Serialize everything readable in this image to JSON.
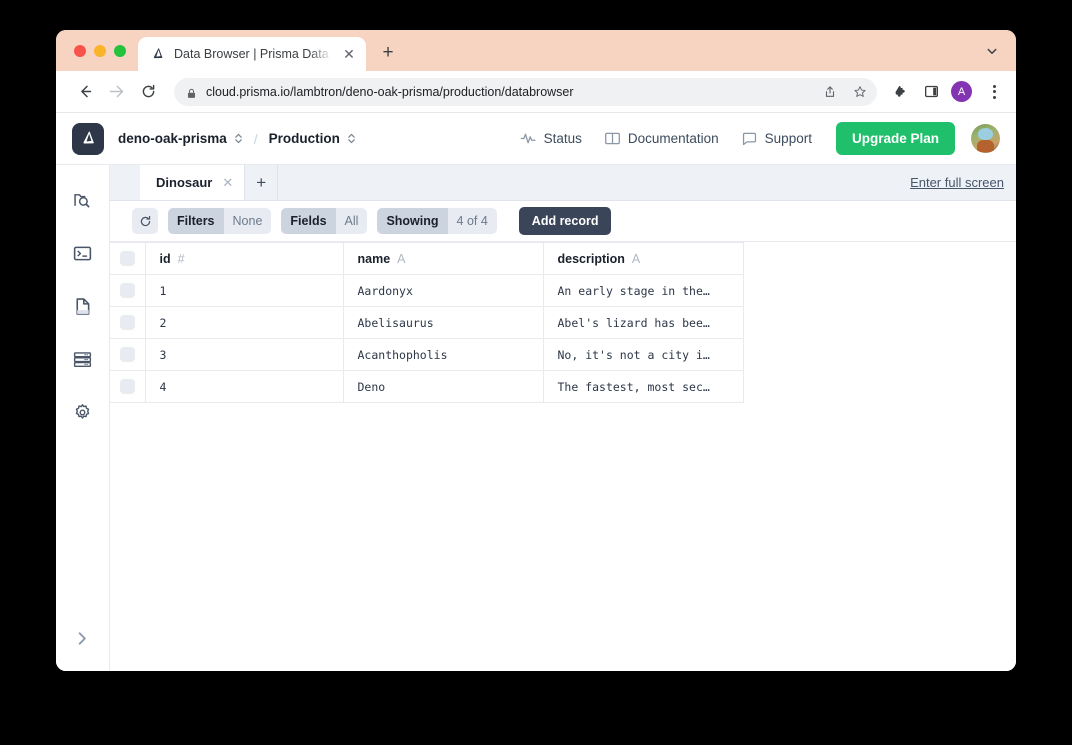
{
  "browser": {
    "tab": {
      "title": "Data Browser | Prisma Data Pla",
      "favicon": "prisma-logo-icon",
      "close": "✕"
    },
    "new_tab": "+",
    "tab_search": "chevron-down-icon",
    "nav": {
      "back": "←",
      "forward": "→",
      "reload": "↻"
    },
    "omnibox": {
      "url": "cloud.prisma.io/lambtron/deno-oak-prisma/production/databrowser",
      "lock": "lock-icon",
      "share": "share-icon",
      "bookmark": "☆"
    },
    "toolbar_icons": {
      "extensions": "puzzle-icon",
      "sidepanel": "side-panel-icon",
      "menu": "kebab-menu-icon"
    },
    "profile_initial": "A",
    "profile_color": "#8334b3"
  },
  "header": {
    "logo": "prisma-logo-icon",
    "project": "deno-oak-prisma",
    "separator": "/",
    "environment": "Production",
    "links": [
      {
        "label": "Status",
        "icon": "activity-pulse-icon"
      },
      {
        "label": "Documentation",
        "icon": "book-icon"
      },
      {
        "label": "Support",
        "icon": "chat-bubble-icon"
      }
    ],
    "upgrade_label": "Upgrade Plan",
    "upgrade_color": "#20bf6b",
    "avatar": "user-avatar"
  },
  "sidebar": {
    "items": [
      {
        "name": "data-browser",
        "icon": "folder-search-icon"
      },
      {
        "name": "query-console",
        "icon": "terminal-icon"
      },
      {
        "name": "schema",
        "icon": "document-icon"
      },
      {
        "name": "database",
        "icon": "server-icon"
      },
      {
        "name": "settings",
        "icon": "gear-icon"
      }
    ],
    "expand": {
      "icon": "chevron-right-icon"
    }
  },
  "model_tabs": {
    "tabs": [
      {
        "label": "Dinosaur",
        "close": "✕",
        "active": true
      }
    ],
    "add_label": "+",
    "fullscreen_label": "Enter full screen"
  },
  "filter_bar": {
    "refresh_icon": "refresh-icon",
    "pills": [
      {
        "key": "Filters",
        "value": "None"
      },
      {
        "key": "Fields",
        "value": "All"
      },
      {
        "key": "Showing",
        "value": "4 of 4"
      }
    ],
    "add_record_label": "Add record"
  },
  "table": {
    "columns": [
      {
        "label": "id",
        "type_glyph": "#"
      },
      {
        "label": "name",
        "type_glyph": "A"
      },
      {
        "label": "description",
        "type_glyph": "A"
      }
    ],
    "rows": [
      {
        "id": "1",
        "name": "Aardonyx",
        "description": "An early stage in the…"
      },
      {
        "id": "2",
        "name": "Abelisaurus",
        "description": "Abel's lizard has bee…"
      },
      {
        "id": "3",
        "name": "Acanthopholis",
        "description": "No, it's not a city i…"
      },
      {
        "id": "4",
        "name": "Deno",
        "description": "The fastest, most sec…"
      }
    ]
  }
}
